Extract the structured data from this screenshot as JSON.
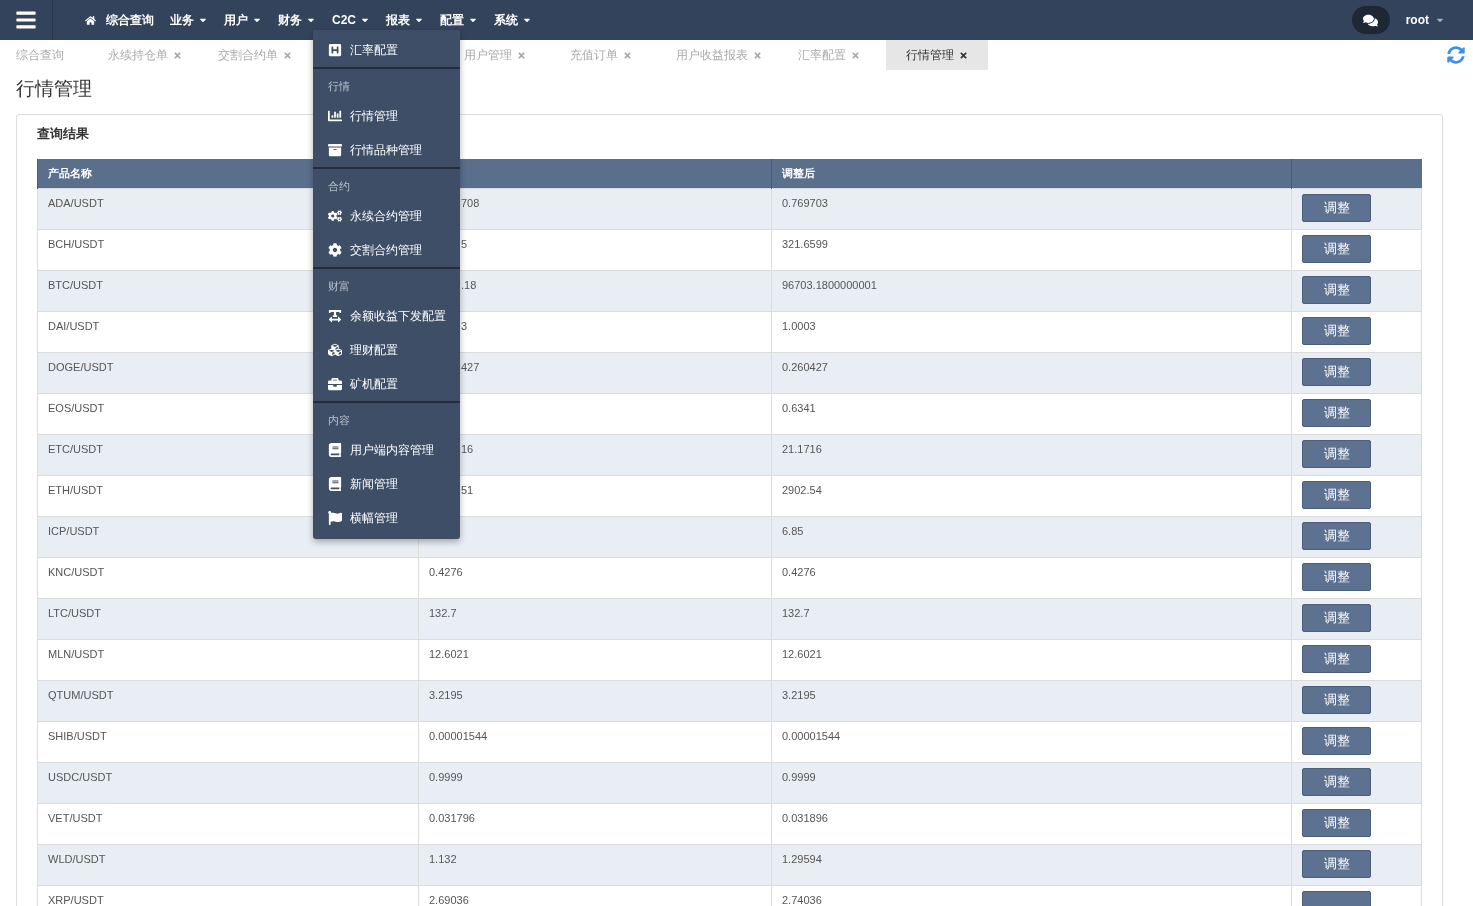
{
  "nav": {
    "items": [
      {
        "label": "综合查询",
        "kind": "home"
      },
      {
        "label": "业务",
        "kind": "dropdown"
      },
      {
        "label": "用户",
        "kind": "dropdown"
      },
      {
        "label": "财务",
        "kind": "dropdown"
      },
      {
        "label": "C2C",
        "kind": "dropdown"
      },
      {
        "label": "报表",
        "kind": "dropdown"
      },
      {
        "label": "配置",
        "kind": "dropdown"
      },
      {
        "label": "系统",
        "kind": "dropdown"
      }
    ],
    "user": "root"
  },
  "tabs": [
    {
      "label": "综合查询",
      "closable": false,
      "selected": false
    },
    {
      "label": "永续持仓单",
      "closable": true,
      "selected": false
    },
    {
      "label": "交割合约单",
      "closable": true,
      "selected": false
    },
    {
      "label": "用户管理",
      "closable": true,
      "selected": false
    },
    {
      "label": "充值订单",
      "closable": true,
      "selected": false
    },
    {
      "label": "用户收益报表",
      "closable": true,
      "selected": false
    },
    {
      "label": "汇率配置",
      "closable": true,
      "selected": false
    },
    {
      "label": "行情管理",
      "closable": true,
      "selected": true
    }
  ],
  "page_title": "行情管理",
  "panel_title": "查询结果",
  "table": {
    "columns": {
      "column_1": "产品名称",
      "column_3": "调整后"
    },
    "rows": [
      {
        "product": "ADA/USDT",
        "column_2": "708",
        "adjusted": "0.769703",
        "action": "调整",
        "covered": true
      },
      {
        "product": "BCH/USDT",
        "column_2": "5",
        "adjusted": "321.6599",
        "action": "调整",
        "covered": true
      },
      {
        "product": "BTC/USDT",
        "column_2": ".18",
        "adjusted": "96703.1800000001",
        "action": "调整",
        "covered": true
      },
      {
        "product": "DAI/USDT",
        "column_2": "3",
        "adjusted": "1.0003",
        "action": "调整",
        "covered": true
      },
      {
        "product": "DOGE/USDT",
        "column_2": "427",
        "adjusted": "0.260427",
        "action": "调整",
        "covered": true
      },
      {
        "product": "EOS/USDT",
        "adjusted": "0.6341",
        "action": "调整"
      },
      {
        "product": "ETC/USDT",
        "column_2": "16",
        "adjusted": "21.1716",
        "action": "调整",
        "covered": true
      },
      {
        "product": "ETH/USDT",
        "column_2": "51",
        "adjusted": "2902.54",
        "action": "调整",
        "covered": true
      },
      {
        "product": "ICP/USDT",
        "adjusted": "6.85",
        "action": "调整"
      },
      {
        "product": "KNC/USDT",
        "column_2": "0.4276",
        "adjusted": "0.4276",
        "action": "调整",
        "covered": false
      },
      {
        "product": "LTC/USDT",
        "column_2": "132.7",
        "adjusted": "132.7",
        "action": "调整",
        "covered": false
      },
      {
        "product": "MLN/USDT",
        "column_2": "12.6021",
        "adjusted": "12.6021",
        "action": "调整",
        "covered": false
      },
      {
        "product": "QTUM/USDT",
        "column_2": "3.2195",
        "adjusted": "3.2195",
        "action": "调整",
        "covered": false
      },
      {
        "product": "SHIB/USDT",
        "column_2": "0.00001544",
        "adjusted": "0.00001544",
        "action": "调整",
        "covered": false
      },
      {
        "product": "USDC/USDT",
        "column_2": "0.9999",
        "adjusted": "0.9999",
        "action": "调整",
        "covered": false
      },
      {
        "product": "VET/USDT",
        "column_2": "0.031796",
        "adjusted": "0.031896",
        "action": "调整",
        "covered": false
      },
      {
        "product": "WLD/USDT",
        "column_2": "1.132",
        "adjusted": "1.29594",
        "action": "调整",
        "covered": false
      },
      {
        "product": "XRP/USDT",
        "column_2": "2.69036",
        "adjusted": "2.74036",
        "covered": false
      }
    ]
  },
  "dropdown": {
    "sections": [
      {
        "items": [
          {
            "label": "汇率配置",
            "kind": "h-square"
          }
        ]
      },
      {
        "label": "行情",
        "items": [
          {
            "label": "行情管理",
            "kind": "bar-chart"
          },
          {
            "label": "行情品种管理",
            "kind": "archive"
          }
        ]
      },
      {
        "label": "合约",
        "items": [
          {
            "label": "永续合约管理",
            "kind": "gears"
          },
          {
            "label": "交割合约管理",
            "kind": "gear"
          }
        ]
      },
      {
        "label": "财富",
        "items": [
          {
            "label": "余额收益下发配置",
            "kind": "text"
          },
          {
            "label": "理财配置",
            "kind": "cubes"
          },
          {
            "label": "矿机配置",
            "kind": "briefcase"
          }
        ]
      },
      {
        "label": "内容",
        "items": [
          {
            "label": "用户端内容管理",
            "kind": "book"
          },
          {
            "label": "新闻管理",
            "kind": "book"
          },
          {
            "label": "横幅管理",
            "kind": "flag"
          }
        ]
      }
    ]
  }
}
